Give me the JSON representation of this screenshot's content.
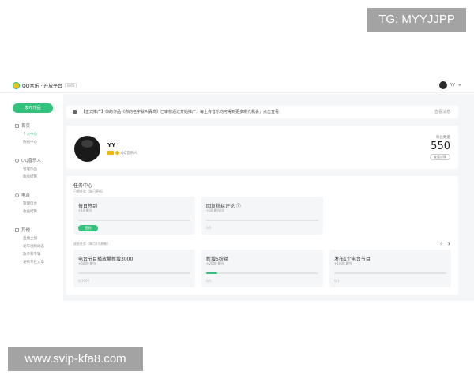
{
  "watermarks": {
    "top": "TG: MYYJJPP",
    "bottom": "www.svip-kfa8.com"
  },
  "header": {
    "brand": "QQ音乐 · 开放平台",
    "brand_tag": "Beta",
    "user_name": "YY"
  },
  "sidebar": {
    "new_button": "发布作品",
    "groups": [
      {
        "title": "首页",
        "icon": "home-icon",
        "items": [
          "个人中心",
          "数据中心"
        ],
        "active": "个人中心"
      },
      {
        "title": "QQ音乐人",
        "icon": "music-note-icon",
        "items": [
          "管理作品",
          "收益结算"
        ]
      },
      {
        "title": "电台",
        "icon": "radio-icon",
        "items": [
          "管理电台",
          "收益结算"
        ]
      },
      {
        "title": "其他",
        "icon": "grid-icon",
        "items": [
          "直播主播",
          "发布视频动态",
          "歌单和专辑",
          "发布专栏文章"
        ]
      }
    ]
  },
  "notice": {
    "text": "【正式推广】你的作品《你的名字就叫青鸟》已审核通过开始推广，每上传音乐均可得到更多曝光机会，点击查看",
    "link": "查看消息"
  },
  "profile": {
    "name": "YY",
    "type_label": "QQ音乐人",
    "fans_label": "粉丝数量",
    "fans_count": "550",
    "fans_button": "查看详情"
  },
  "tasks": {
    "title": "任务中心",
    "daily_label": "日常任务（每日更新）",
    "growth_label": "成长任务（每月1号刷新）",
    "daily": [
      {
        "title": "每日签到",
        "sub": "+10 曝光",
        "progress": 0,
        "action": "签到"
      },
      {
        "title": "回复粉丝评论 ⓘ",
        "sub": "+20 曝光/次",
        "progress": 0,
        "foot": "0/5"
      }
    ],
    "growth": [
      {
        "title": "电台节目播放量新增3000",
        "sub": "+5000 曝光",
        "progress": 0,
        "foot": "0/3000"
      },
      {
        "title": "新增5粉丝",
        "sub": "+2000 曝光",
        "progress": 0.1,
        "foot": "0/5"
      },
      {
        "title": "发布1个电台节目",
        "sub": "+1000 曝光",
        "progress": 0,
        "foot": "0/1"
      }
    ],
    "prev_arrow": "‹",
    "next_arrow": "›"
  },
  "colors": {
    "accent": "#31c27c",
    "vip": "#f4b400",
    "background": "#f5f6f8"
  }
}
